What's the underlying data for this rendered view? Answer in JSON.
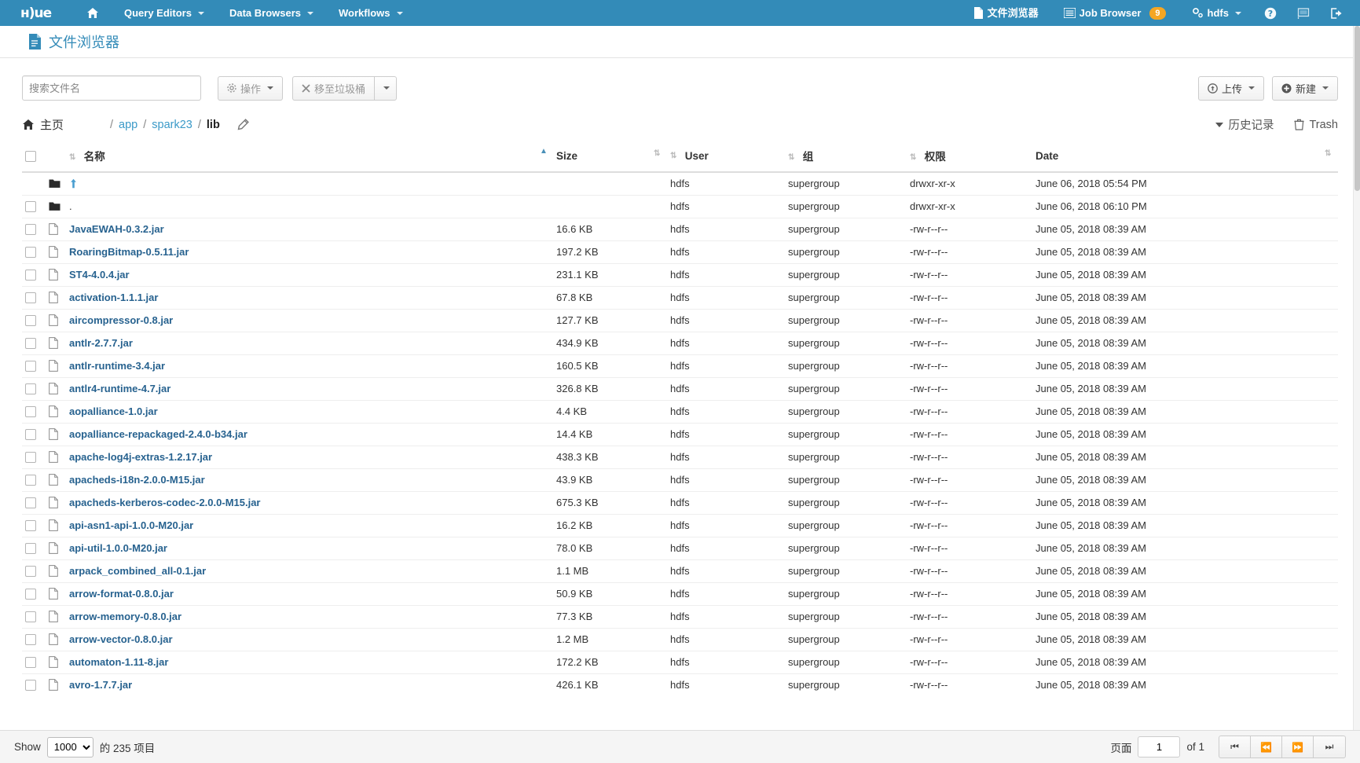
{
  "navbar": {
    "brand": "hue",
    "items": [
      {
        "label": "",
        "icon": "home-icon",
        "caret": false
      },
      {
        "label": "Query Editors",
        "icon": "",
        "caret": true
      },
      {
        "label": "Data Browsers",
        "icon": "",
        "caret": true
      },
      {
        "label": "Workflows",
        "icon": "",
        "caret": true
      }
    ],
    "right": {
      "file_browser": "文件浏览器",
      "job_browser": "Job Browser",
      "job_badge": "9",
      "user": "hdfs",
      "help_icon": "question-circle-icon",
      "flag_icon": "flag-icon",
      "logout_icon": "logout-icon"
    }
  },
  "page": {
    "title": "文件浏览器",
    "title_icon": "file-text-icon"
  },
  "toolbar": {
    "search_placeholder": "搜索文件名",
    "search_value": "",
    "actions_label": "操作",
    "trash_label": "移至垃圾桶",
    "upload_label": "上传",
    "new_label": "新建"
  },
  "breadcrumb": {
    "home_label": "主页",
    "segments": [
      "app",
      "spark23",
      "lib"
    ],
    "current": "lib",
    "history_label": "历史记录",
    "trash_label": "Trash"
  },
  "table": {
    "headers": {
      "name": "名称",
      "size": "Size",
      "user": "User",
      "group": "组",
      "permission": "权限",
      "date": "Date"
    },
    "rows": [
      {
        "name": "..",
        "type": "up",
        "size": "",
        "user": "hdfs",
        "group": "supergroup",
        "perm": "drwxr-xr-x",
        "date": "June 06, 2018 05:54 PM",
        "checkbox": false
      },
      {
        "name": ".",
        "type": "folder",
        "size": "",
        "user": "hdfs",
        "group": "supergroup",
        "perm": "drwxr-xr-x",
        "date": "June 06, 2018 06:10 PM",
        "checkbox": true
      },
      {
        "name": "JavaEWAH-0.3.2.jar",
        "type": "file",
        "size": "16.6 KB",
        "user": "hdfs",
        "group": "supergroup",
        "perm": "-rw-r--r--",
        "date": "June 05, 2018 08:39 AM",
        "checkbox": true
      },
      {
        "name": "RoaringBitmap-0.5.11.jar",
        "type": "file",
        "size": "197.2 KB",
        "user": "hdfs",
        "group": "supergroup",
        "perm": "-rw-r--r--",
        "date": "June 05, 2018 08:39 AM",
        "checkbox": true
      },
      {
        "name": "ST4-4.0.4.jar",
        "type": "file",
        "size": "231.1 KB",
        "user": "hdfs",
        "group": "supergroup",
        "perm": "-rw-r--r--",
        "date": "June 05, 2018 08:39 AM",
        "checkbox": true
      },
      {
        "name": "activation-1.1.1.jar",
        "type": "file",
        "size": "67.8 KB",
        "user": "hdfs",
        "group": "supergroup",
        "perm": "-rw-r--r--",
        "date": "June 05, 2018 08:39 AM",
        "checkbox": true
      },
      {
        "name": "aircompressor-0.8.jar",
        "type": "file",
        "size": "127.7 KB",
        "user": "hdfs",
        "group": "supergroup",
        "perm": "-rw-r--r--",
        "date": "June 05, 2018 08:39 AM",
        "checkbox": true
      },
      {
        "name": "antlr-2.7.7.jar",
        "type": "file",
        "size": "434.9 KB",
        "user": "hdfs",
        "group": "supergroup",
        "perm": "-rw-r--r--",
        "date": "June 05, 2018 08:39 AM",
        "checkbox": true
      },
      {
        "name": "antlr-runtime-3.4.jar",
        "type": "file",
        "size": "160.5 KB",
        "user": "hdfs",
        "group": "supergroup",
        "perm": "-rw-r--r--",
        "date": "June 05, 2018 08:39 AM",
        "checkbox": true
      },
      {
        "name": "antlr4-runtime-4.7.jar",
        "type": "file",
        "size": "326.8 KB",
        "user": "hdfs",
        "group": "supergroup",
        "perm": "-rw-r--r--",
        "date": "June 05, 2018 08:39 AM",
        "checkbox": true
      },
      {
        "name": "aopalliance-1.0.jar",
        "type": "file",
        "size": "4.4 KB",
        "user": "hdfs",
        "group": "supergroup",
        "perm": "-rw-r--r--",
        "date": "June 05, 2018 08:39 AM",
        "checkbox": true
      },
      {
        "name": "aopalliance-repackaged-2.4.0-b34.jar",
        "type": "file",
        "size": "14.4 KB",
        "user": "hdfs",
        "group": "supergroup",
        "perm": "-rw-r--r--",
        "date": "June 05, 2018 08:39 AM",
        "checkbox": true
      },
      {
        "name": "apache-log4j-extras-1.2.17.jar",
        "type": "file",
        "size": "438.3 KB",
        "user": "hdfs",
        "group": "supergroup",
        "perm": "-rw-r--r--",
        "date": "June 05, 2018 08:39 AM",
        "checkbox": true
      },
      {
        "name": "apacheds-i18n-2.0.0-M15.jar",
        "type": "file",
        "size": "43.9 KB",
        "user": "hdfs",
        "group": "supergroup",
        "perm": "-rw-r--r--",
        "date": "June 05, 2018 08:39 AM",
        "checkbox": true
      },
      {
        "name": "apacheds-kerberos-codec-2.0.0-M15.jar",
        "type": "file",
        "size": "675.3 KB",
        "user": "hdfs",
        "group": "supergroup",
        "perm": "-rw-r--r--",
        "date": "June 05, 2018 08:39 AM",
        "checkbox": true
      },
      {
        "name": "api-asn1-api-1.0.0-M20.jar",
        "type": "file",
        "size": "16.2 KB",
        "user": "hdfs",
        "group": "supergroup",
        "perm": "-rw-r--r--",
        "date": "June 05, 2018 08:39 AM",
        "checkbox": true
      },
      {
        "name": "api-util-1.0.0-M20.jar",
        "type": "file",
        "size": "78.0 KB",
        "user": "hdfs",
        "group": "supergroup",
        "perm": "-rw-r--r--",
        "date": "June 05, 2018 08:39 AM",
        "checkbox": true
      },
      {
        "name": "arpack_combined_all-0.1.jar",
        "type": "file",
        "size": "1.1 MB",
        "user": "hdfs",
        "group": "supergroup",
        "perm": "-rw-r--r--",
        "date": "June 05, 2018 08:39 AM",
        "checkbox": true
      },
      {
        "name": "arrow-format-0.8.0.jar",
        "type": "file",
        "size": "50.9 KB",
        "user": "hdfs",
        "group": "supergroup",
        "perm": "-rw-r--r--",
        "date": "June 05, 2018 08:39 AM",
        "checkbox": true
      },
      {
        "name": "arrow-memory-0.8.0.jar",
        "type": "file",
        "size": "77.3 KB",
        "user": "hdfs",
        "group": "supergroup",
        "perm": "-rw-r--r--",
        "date": "June 05, 2018 08:39 AM",
        "checkbox": true
      },
      {
        "name": "arrow-vector-0.8.0.jar",
        "type": "file",
        "size": "1.2 MB",
        "user": "hdfs",
        "group": "supergroup",
        "perm": "-rw-r--r--",
        "date": "June 05, 2018 08:39 AM",
        "checkbox": true
      },
      {
        "name": "automaton-1.11-8.jar",
        "type": "file",
        "size": "172.2 KB",
        "user": "hdfs",
        "group": "supergroup",
        "perm": "-rw-r--r--",
        "date": "June 05, 2018 08:39 AM",
        "checkbox": true
      },
      {
        "name": "avro-1.7.7.jar",
        "type": "file",
        "size": "426.1 KB",
        "user": "hdfs",
        "group": "supergroup",
        "perm": "-rw-r--r--",
        "date": "June 05, 2018 08:39 AM",
        "checkbox": true
      }
    ]
  },
  "footer": {
    "show_label": "Show",
    "page_size": "1000",
    "count_text": "的 235 项目",
    "page_label": "页面",
    "page_number": "1",
    "of_label": "of 1"
  },
  "colors": {
    "brand": "#338BB8",
    "link": "#27628f",
    "badge": "#F5A623"
  }
}
